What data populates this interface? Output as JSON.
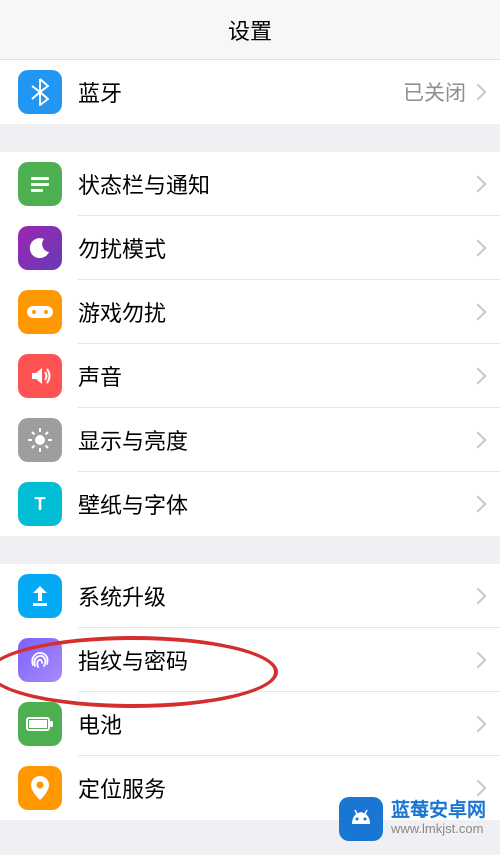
{
  "header": {
    "title": "设置"
  },
  "bluetooth": {
    "label": "蓝牙",
    "value": "已关闭"
  },
  "group2": {
    "status": "状态栏与通知",
    "dnd": "勿扰模式",
    "game": "游戏勿扰",
    "sound": "声音",
    "display": "显示与亮度",
    "wallpaper": "壁纸与字体"
  },
  "group3": {
    "update": "系统升级",
    "fingerprint": "指纹与密码",
    "battery": "电池",
    "location": "定位服务"
  },
  "watermark": {
    "title": "蓝莓安卓网",
    "url": "www.lmkjst.com"
  }
}
